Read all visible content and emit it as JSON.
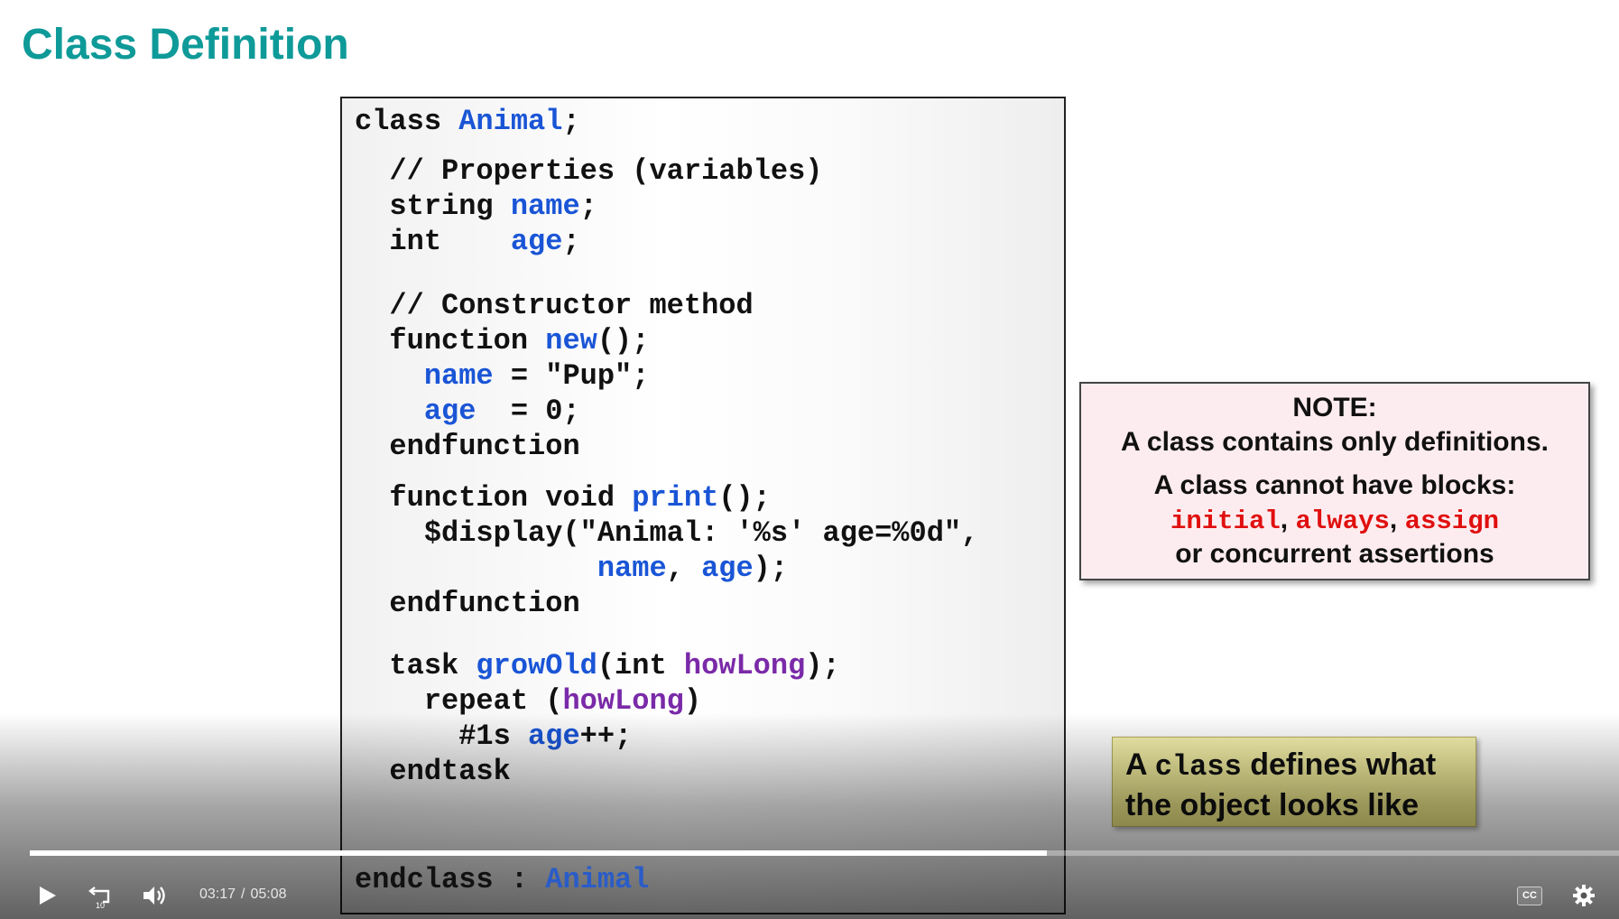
{
  "slide": {
    "title": "Class Definition",
    "code": {
      "l1_kw": "class ",
      "l1_name": "Animal",
      "l1_end": ";",
      "l2": "  // Properties (variables)",
      "l3_kw": "  string ",
      "l3_name": "name",
      "l3_end": ";",
      "l4_kw": "  int    ",
      "l4_name": "age",
      "l4_end": ";",
      "l5": "  // Constructor method",
      "l6_kw": "  function ",
      "l6_name": "new",
      "l6_end": "();",
      "l7_pre": "    ",
      "l7_name": "name",
      "l7_end": " = \"Pup\";",
      "l8_pre": "    ",
      "l8_name": "age",
      "l8_end": "  = 0;",
      "l9": "  endfunction",
      "l10_kw": "  function void ",
      "l10_name": "print",
      "l10_end": "();",
      "l11": "    $display(\"Animal: '%s' age=%0d\",",
      "l12_pre": "              ",
      "l12_name1": "name",
      "l12_mid": ", ",
      "l12_name2": "age",
      "l12_end": ");",
      "l13": "  endfunction",
      "l14_kw": "  task ",
      "l14_name": "growOld",
      "l14_mid": "(int ",
      "l14_arg": "howLong",
      "l14_end": ");",
      "l15_kw": "    repeat (",
      "l15_arg": "howLong",
      "l15_end": ")",
      "l16_kw": "      #1s ",
      "l16_name": "age",
      "l16_end": "++;",
      "l17": "  endtask",
      "end_kw": "endclass : ",
      "end_name": "Animal"
    },
    "note": {
      "heading": "NOTE:",
      "line1": "A class contains only definitions.",
      "line2": "A class cannot have blocks:",
      "kw1": "initial",
      "kw2": "always",
      "kw3": "assign",
      "comma": ",",
      "line3": "or concurrent assertions"
    },
    "callout": {
      "pre": "A ",
      "mono": "class",
      "post": " defines what",
      "line2": "the object looks like"
    }
  },
  "player": {
    "current_time": "03:17",
    "separator": "/",
    "duration": "05:08",
    "progress_fraction": 0.64,
    "cc_label": "CC",
    "icons": [
      "play-icon",
      "replay-10-icon",
      "volume-icon",
      "captions-icon",
      "settings-icon"
    ]
  },
  "colors": {
    "title": "#0e9a98",
    "code_blue": "#1a55d6",
    "code_purple": "#7a2aa8",
    "keyword_red": "#e01010",
    "note_bg": "#fdecef",
    "callout_bg": "#efe98f"
  }
}
